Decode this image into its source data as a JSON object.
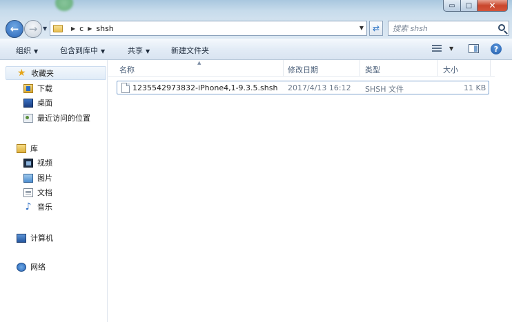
{
  "window": {
    "minimize_glyph": "▭",
    "maximize_glyph": "□",
    "close_glyph": "✕"
  },
  "address": {
    "crumbs": [
      "c",
      "shsh"
    ],
    "search_placeholder": "搜索 shsh"
  },
  "toolbar": {
    "organize": "组织",
    "include_in_library": "包含到库中",
    "share": "共享",
    "new_folder": "新建文件夹"
  },
  "sidebar": {
    "favorites": "收藏夹",
    "downloads": "下载",
    "desktop": "桌面",
    "recent": "最近访问的位置",
    "libraries": "库",
    "videos": "视频",
    "pictures": "图片",
    "documents": "文档",
    "music": "音乐",
    "computer": "计算机",
    "network": "网络"
  },
  "columns": {
    "name": "名称",
    "modified": "修改日期",
    "type": "类型",
    "size": "大小"
  },
  "files": [
    {
      "name": "1235542973832-iPhone4,1-9.3.5.shsh",
      "modified": "2017/4/13 16:12",
      "type": "SHSH 文件",
      "size": "11 KB"
    }
  ]
}
